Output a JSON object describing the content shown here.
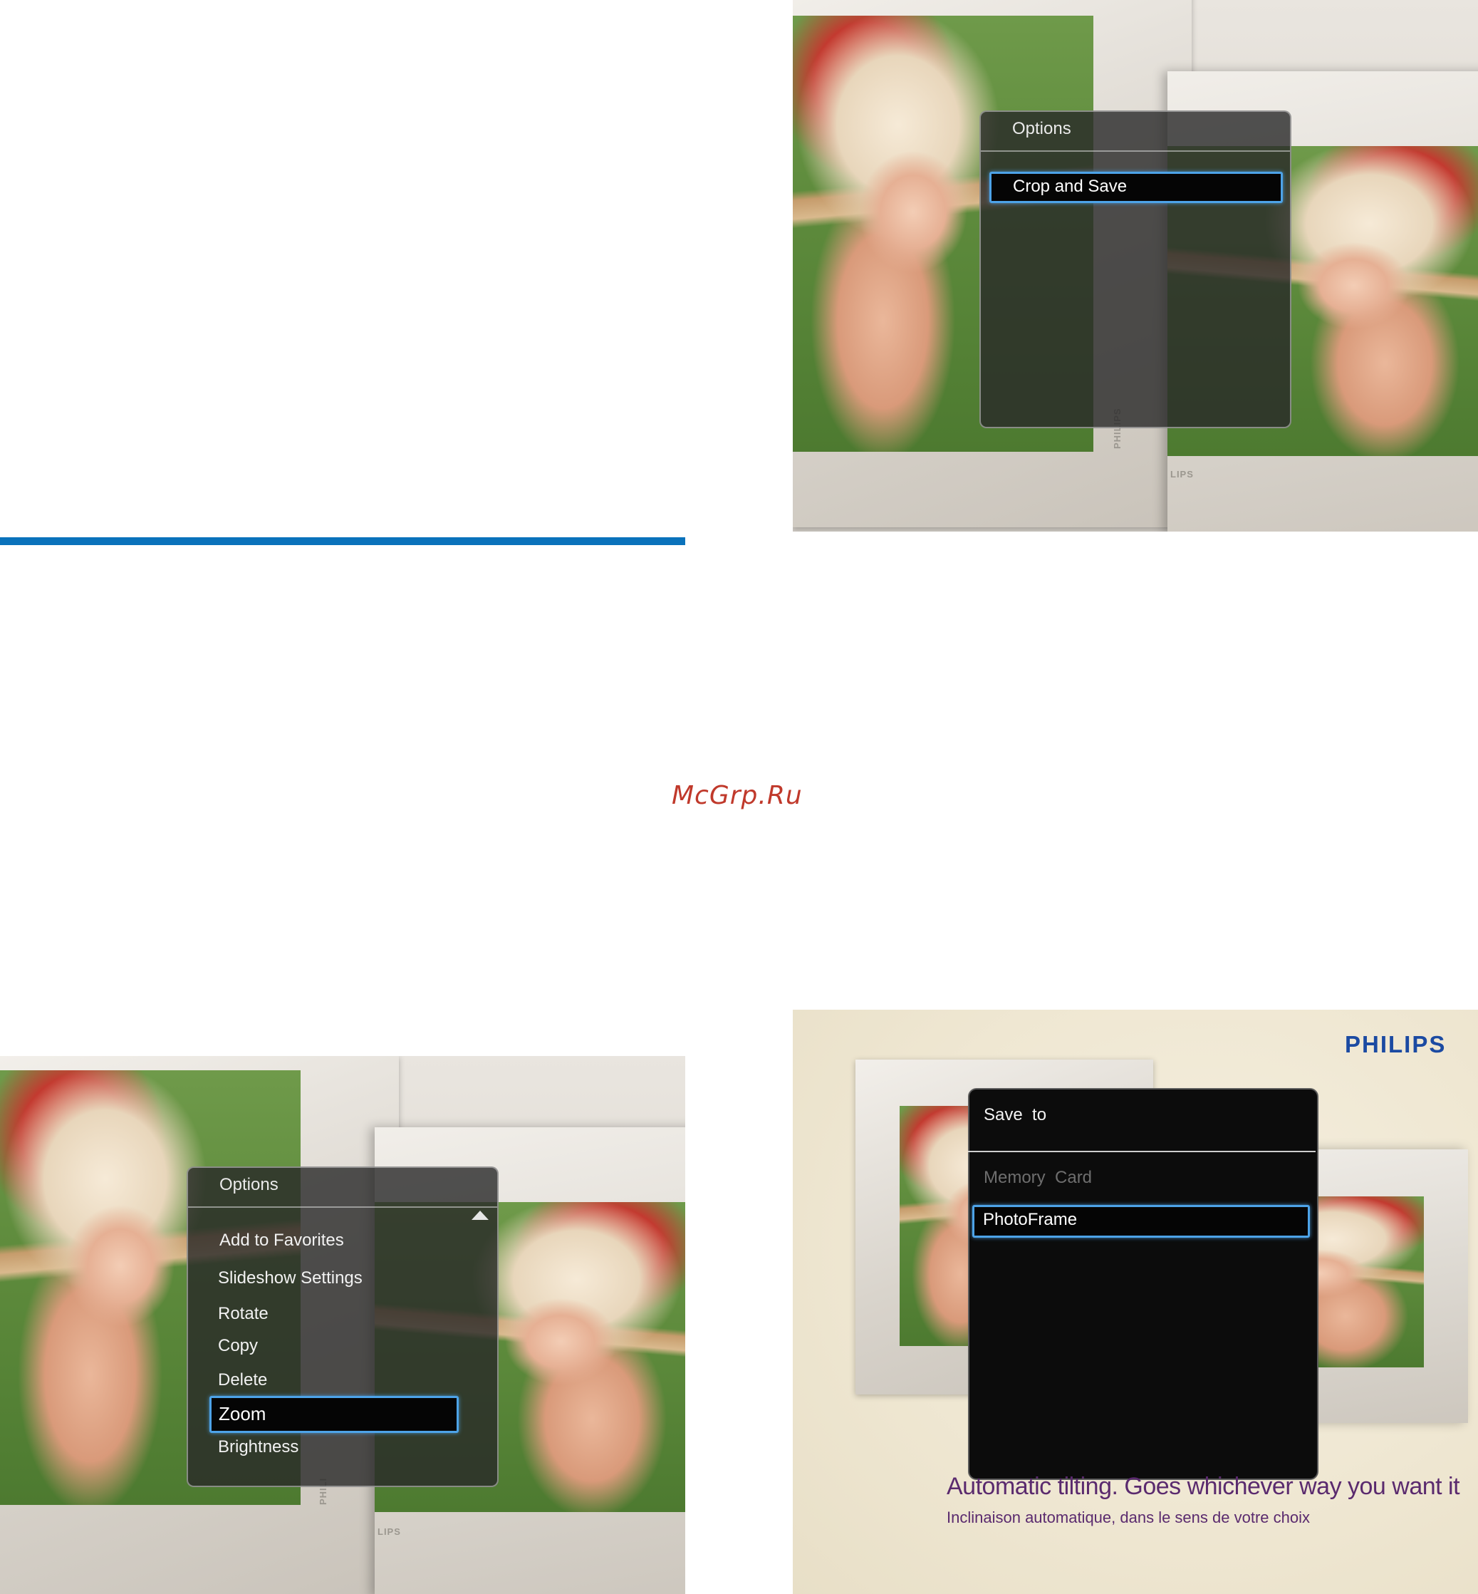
{
  "watermark": "McGrp.Ru",
  "crop_screen": {
    "menu_title": "Options",
    "selected_item": "Crop and Save",
    "brand_vertical": "PHILIPS",
    "brand_fragment": "LIPS"
  },
  "options_screen": {
    "menu_title": "Options",
    "items": [
      "Add to Favorites",
      "Slideshow Settings",
      "Rotate",
      "Copy",
      "Delete"
    ],
    "selected_item": "Zoom",
    "after_selected": "Brightness",
    "brand_vertical": "PHILI",
    "brand_fragment": "LIPS"
  },
  "save_screen": {
    "brand_logo": "PHILIPS",
    "dialog_title": "Save  to",
    "disabled_item": "Memory  Card",
    "selected_item": "PhotoFrame",
    "tagline_en": "Automatic tilting. Goes whichever way you want it",
    "tagline_fr": "Inclinaison automatique, dans le sens de votre choix"
  },
  "colors": {
    "rule": "#0a72bb",
    "selection_border": "#4da3e8",
    "watermark": "#c0392b",
    "brand_logo": "#1b4aa2",
    "tagline": "#5a2a6e"
  }
}
